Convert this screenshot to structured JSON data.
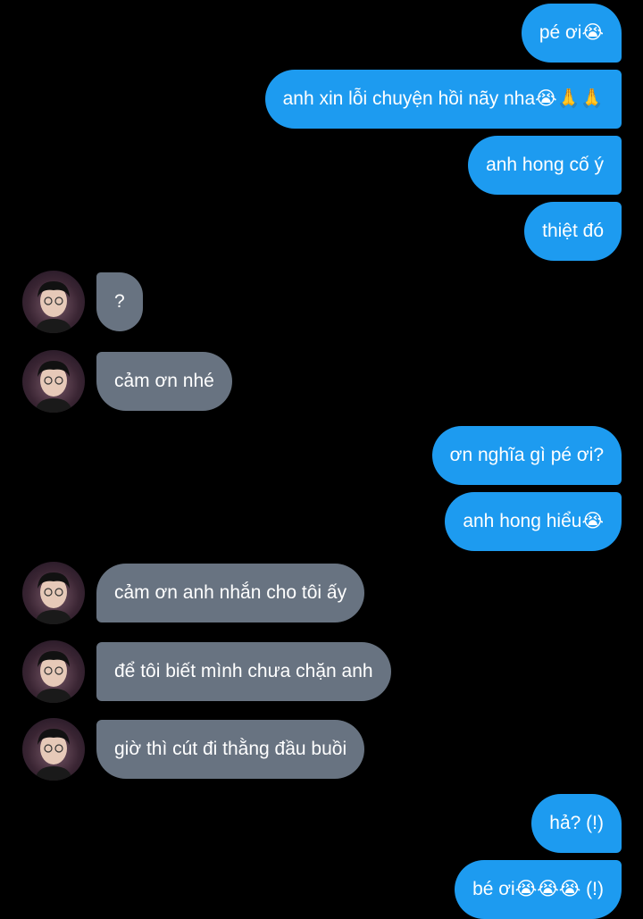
{
  "conversation": {
    "messages": [
      {
        "side": "sent",
        "text": "pé ơi😭"
      },
      {
        "side": "sent",
        "text": "anh xin lỗi chuyện hồi nãy nha😭🙏🙏"
      },
      {
        "side": "sent",
        "text": "anh hong cố ý"
      },
      {
        "side": "sent",
        "text": "thiệt đó"
      },
      {
        "side": "received",
        "text": "?"
      },
      {
        "side": "received",
        "text": "cảm ơn nhé"
      },
      {
        "side": "sent",
        "text": "ơn nghĩa gì pé ơi?"
      },
      {
        "side": "sent",
        "text": "anh hong hiểu😭"
      },
      {
        "side": "received",
        "text": "cảm ơn anh nhắn cho tôi ấy"
      },
      {
        "side": "received",
        "text": "để tôi biết mình chưa chặn anh"
      },
      {
        "side": "received",
        "text": "giờ thì cút đi thằng đầu buồi"
      },
      {
        "side": "sent",
        "text": "hả? (!)"
      },
      {
        "side": "sent",
        "text": "bé ơi😭😭😭 (!)"
      }
    ]
  },
  "colors": {
    "background": "#000000",
    "sent_bubble": "#1d9bf0",
    "received_bubble": "#687381",
    "text": "#ffffff"
  },
  "avatar_icon": "user-avatar-icon"
}
